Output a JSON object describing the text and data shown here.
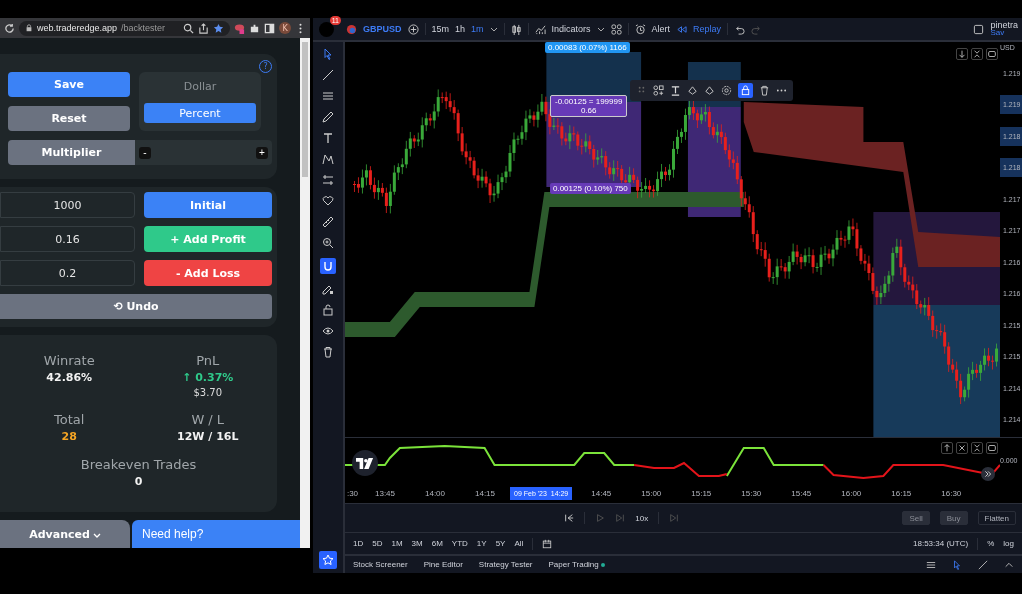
{
  "browser": {
    "host": "web.traderedge.app",
    "path": "/backtester",
    "profile": "K"
  },
  "settings": {
    "help": "?",
    "save": "Save",
    "reset": "Reset",
    "mode_options": [
      {
        "label": "Dollar",
        "selected": false
      },
      {
        "label": "Percent",
        "selected": true
      }
    ],
    "multiplier": {
      "label": "Multiplier",
      "decrement": "-",
      "increment": "+"
    }
  },
  "inputs": [
    {
      "value": "1000",
      "button": "Initial",
      "kind": "initial"
    },
    {
      "value": "0.16",
      "button": "+ Add Profit",
      "kind": "profit"
    },
    {
      "value": "0.2",
      "button": "- Add Loss",
      "kind": "loss"
    }
  ],
  "undo": {
    "icon": "⟲",
    "label": "Undo"
  },
  "stats": [
    {
      "label": "Winrate",
      "value": "42.86%",
      "kind": "plain"
    },
    {
      "label": "PnL",
      "icon": "↑",
      "value": "0.37%",
      "sub": "$3.70",
      "kind": "up"
    },
    {
      "label": "Total",
      "value": "28",
      "kind": "count"
    },
    {
      "label": "W / L",
      "value": "12W / 16L",
      "kind": "plain"
    }
  ],
  "breakeven": {
    "label": "Breakeven Trades",
    "value": "0"
  },
  "advanced": "Advanced",
  "help_chat": "Need help?",
  "chart": {
    "notifications": "11",
    "symbol": "GBPUSD",
    "intervals": [
      {
        "label": "15m",
        "selected": false
      },
      {
        "label": "1h",
        "selected": false
      },
      {
        "label": "1m",
        "selected": true
      }
    ],
    "indicators": "Indicators",
    "alert": "Alert",
    "replay": "Replay",
    "account": "pinetra",
    "account_sub": "Sav",
    "currency": "USD",
    "price_labels": [
      {
        "label": "1.219",
        "highlighted": false
      },
      {
        "label": "1.219",
        "highlighted": true
      },
      {
        "label": "1.218",
        "highlighted": true
      },
      {
        "label": "1.218",
        "highlighted": true
      },
      {
        "label": "1.217",
        "highlighted": false
      },
      {
        "label": "1.217",
        "highlighted": false
      },
      {
        "label": "1.216",
        "highlighted": false
      },
      {
        "label": "1.216",
        "highlighted": false
      },
      {
        "label": "1.215",
        "highlighted": false
      },
      {
        "label": "1.215",
        "highlighted": false
      },
      {
        "label": "1.214",
        "highlighted": false
      },
      {
        "label": "1.214",
        "highlighted": false
      }
    ],
    "measures": [
      {
        "text": "0.00083 (0.07%) 1166"
      },
      {
        "text": "-0.00125 = 199999",
        "sub": "0.66"
      },
      {
        "text": "0.00125 (0.10%) 750"
      }
    ],
    "oscillator_value": "0.000",
    "time_labels": [
      {
        "label": ":30",
        "kind": "tick"
      },
      {
        "label": "13:45",
        "kind": "tick"
      },
      {
        "label": "14:00",
        "kind": "tick"
      },
      {
        "label": "14:15",
        "kind": "tick"
      },
      {
        "label": "09 Feb '23  14:29",
        "kind": "cursor"
      },
      {
        "label": "14:45",
        "kind": "tick"
      },
      {
        "label": "15:00",
        "kind": "tick"
      },
      {
        "label": "15:15",
        "kind": "tick"
      },
      {
        "label": "15:30",
        "kind": "tick"
      },
      {
        "label": "15:45",
        "kind": "tick"
      },
      {
        "label": "16:00",
        "kind": "tick"
      },
      {
        "label": "16:15",
        "kind": "tick"
      },
      {
        "label": "16:30",
        "kind": "tick"
      }
    ],
    "speed": "10x",
    "trade_buttons": [
      {
        "label": "Sell",
        "disabled": true
      },
      {
        "label": "Buy",
        "disabled": true
      },
      {
        "label": "Flatten",
        "disabled": false
      }
    ],
    "ranges": [
      "1D",
      "5D",
      "1M",
      "3M",
      "6M",
      "YTD",
      "1Y",
      "5Y",
      "All"
    ],
    "clock": "18:53:34 (UTC)",
    "percent": "%",
    "log": "log",
    "bottom_tabs": [
      "Stock Screener",
      "Pine Editor",
      "Strategy Tester",
      "Paper Trading"
    ]
  }
}
